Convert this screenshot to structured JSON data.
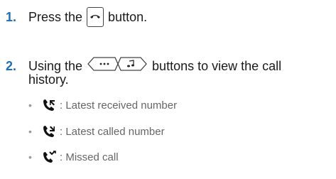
{
  "steps": [
    {
      "number": "1.",
      "text_before": "Press the",
      "text_after": "button.",
      "key_icon": "call-end-key-icon"
    },
    {
      "number": "2.",
      "text_before": "Using the",
      "text_after": "buttons to view the call",
      "text_cont": "history.",
      "key_icons": [
        "nav-left-key-icon",
        "nav-right-key-icon"
      ]
    }
  ],
  "history_items": [
    {
      "icon": "received-call-icon",
      "separator": ":",
      "label": "Latest received number"
    },
    {
      "icon": "dialed-call-icon",
      "separator": ":",
      "label": "Latest called number"
    },
    {
      "icon": "missed-call-icon",
      "separator": ":",
      "label": "Missed call"
    }
  ],
  "colors": {
    "step_number": "#1f6fb5",
    "body_text": "#1a1a1a",
    "bullet_text": "#666666"
  }
}
